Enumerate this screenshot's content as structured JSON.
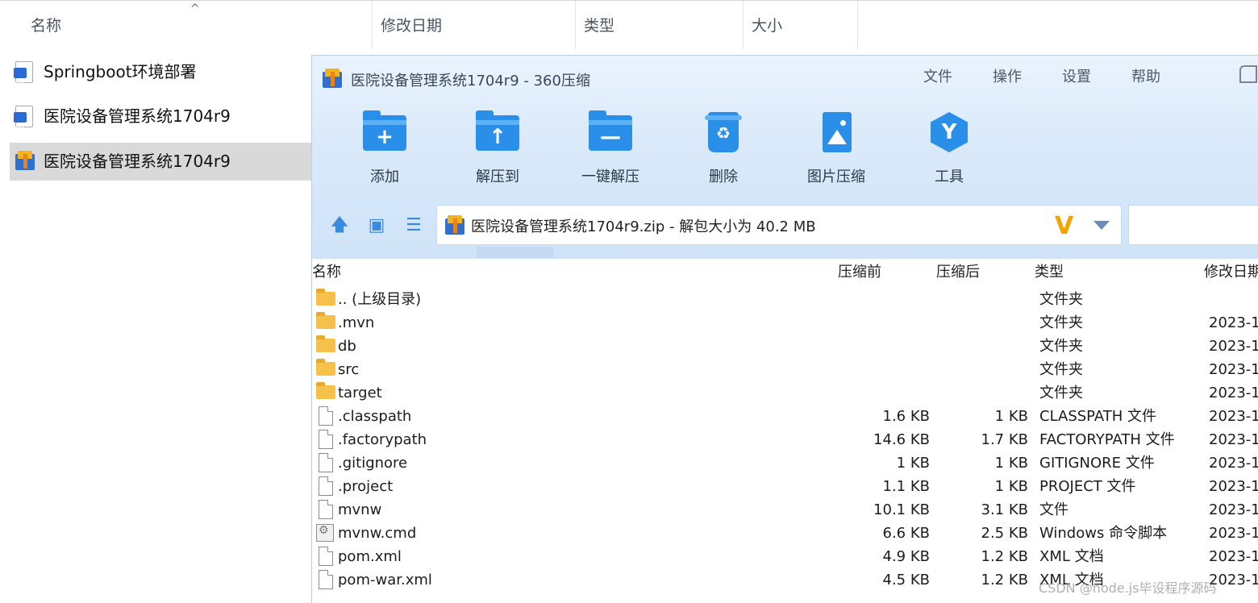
{
  "explorer": {
    "columns": [
      "名称",
      "修改日期",
      "类型",
      "大小"
    ],
    "sort_arrow": "^",
    "items": [
      {
        "name": "Springboot环境部署",
        "icon": "word-doc-icon"
      },
      {
        "name": "医院设备管理系统1704r9",
        "icon": "word-doc-icon"
      },
      {
        "name": "医院设备管理系统1704r9",
        "icon": "360zip-archive-icon",
        "selected": true
      }
    ]
  },
  "zip": {
    "title": "医院设备管理系统1704r9 - 360压缩",
    "menu": [
      "文件",
      "操作",
      "设置",
      "帮助"
    ],
    "tools": [
      {
        "label": "添加",
        "glyph": "+",
        "icon": "add-folder-icon"
      },
      {
        "label": "解压到",
        "glyph": "↑",
        "icon": "extract-to-icon"
      },
      {
        "label": "一键解压",
        "glyph": "—",
        "icon": "one-click-extract-icon"
      },
      {
        "label": "删除",
        "glyph": "♻",
        "icon": "delete-bin-icon"
      },
      {
        "label": "图片压缩",
        "glyph": "",
        "icon": "image-compress-icon"
      },
      {
        "label": "工具",
        "glyph": "Y",
        "icon": "tools-icon"
      }
    ],
    "nav_glyphs": {
      "up": "🡅",
      "view": "▣",
      "list": "☰"
    },
    "address": "医院设备管理系统1704r9.zip - 解包大小为 40.2 MB",
    "v_logo": "V",
    "columns": {
      "name": "名称",
      "before": "压缩前",
      "after": "压缩后",
      "type": "类型",
      "date": "修改日期"
    },
    "rows": [
      {
        "name": ".. (上级目录)",
        "before": "",
        "after": "",
        "type": "文件夹",
        "date": "",
        "kind": "folder"
      },
      {
        "name": ".mvn",
        "before": "",
        "after": "",
        "type": "文件夹",
        "date": "2023-1",
        "kind": "folder"
      },
      {
        "name": "db",
        "before": "",
        "after": "",
        "type": "文件夹",
        "date": "2023-1",
        "kind": "folder"
      },
      {
        "name": "src",
        "before": "",
        "after": "",
        "type": "文件夹",
        "date": "2023-1",
        "kind": "folder"
      },
      {
        "name": "target",
        "before": "",
        "after": "",
        "type": "文件夹",
        "date": "2023-1",
        "kind": "folder"
      },
      {
        "name": ".classpath",
        "before": "1.6 KB",
        "after": "1 KB",
        "type": "CLASSPATH 文件",
        "date": "2023-1",
        "kind": "file"
      },
      {
        "name": ".factorypath",
        "before": "14.6 KB",
        "after": "1.7 KB",
        "type": "FACTORYPATH 文件",
        "date": "2023-1",
        "kind": "file"
      },
      {
        "name": ".gitignore",
        "before": "1 KB",
        "after": "1 KB",
        "type": "GITIGNORE 文件",
        "date": "2023-1",
        "kind": "file"
      },
      {
        "name": ".project",
        "before": "1.1 KB",
        "after": "1 KB",
        "type": "PROJECT 文件",
        "date": "2023-1",
        "kind": "file"
      },
      {
        "name": "mvnw",
        "before": "10.1 KB",
        "after": "3.1 KB",
        "type": "文件",
        "date": "2023-1",
        "kind": "file"
      },
      {
        "name": "mvnw.cmd",
        "before": "6.6 KB",
        "after": "2.5 KB",
        "type": "Windows 命令脚本",
        "date": "2023-1",
        "kind": "cmd"
      },
      {
        "name": "pom.xml",
        "before": "4.9 KB",
        "after": "1.2 KB",
        "type": "XML 文档",
        "date": "2023-1",
        "kind": "file"
      },
      {
        "name": "pom-war.xml",
        "before": "4.5 KB",
        "after": "1.2 KB",
        "type": "XML 文档",
        "date": "2023-1",
        "kind": "file"
      }
    ]
  },
  "watermark": "CSDN @node.js毕设程序源码",
  "colors": {
    "accent": "#2a8fe8",
    "toolbar_bg": "#dbeafa",
    "selected": "#d9d9d9"
  }
}
